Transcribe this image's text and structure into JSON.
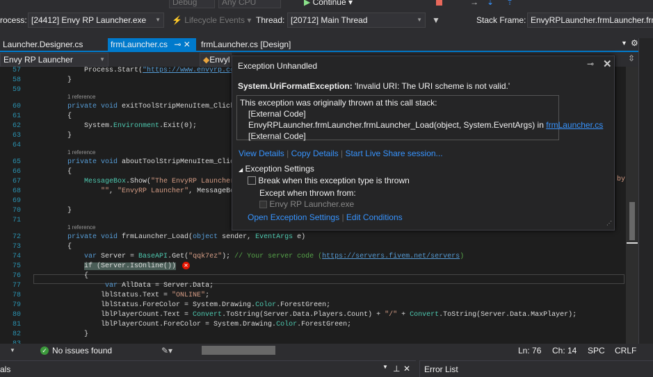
{
  "toolbar": {
    "config": "Debug",
    "platform": "Any CPU",
    "continue_label": "Continue"
  },
  "debug_bar": {
    "process_label": "rocess:",
    "process_value": "[24412] Envy RP Launcher.exe",
    "lifecycle_label": "Lifecycle Events",
    "thread_label": "Thread:",
    "thread_value": "[20712] Main Thread",
    "stack_frame_label": "Stack Frame:",
    "stack_frame_value": "EnvyRPLauncher.frmLauncher.frmL"
  },
  "tabs": [
    {
      "label": "Launcher.Designer.cs"
    },
    {
      "label": "frmLauncher.cs"
    },
    {
      "label": "frmLauncher.cs [Design]"
    }
  ],
  "navbar": {
    "project": "Envy RP Launcher",
    "class": "Envyl"
  },
  "code_lines": [
    {
      "n": "57",
      "tokens": [
        [
          "            Process.Start(",
          ""
        ],
        [
          "\"https://www.envyrp.co",
          "lk"
        ]
      ]
    },
    {
      "n": "58",
      "tokens": [
        [
          "        }",
          ""
        ]
      ]
    },
    {
      "n": "59",
      "tokens": []
    },
    {
      "ref": "1 reference"
    },
    {
      "n": "60",
      "tokens": [
        [
          "        ",
          ""
        ],
        [
          "private void ",
          "kw"
        ],
        [
          "exitToolStripMenuItem_Click",
          ""
        ]
      ]
    },
    {
      "n": "61",
      "tokens": [
        [
          "        {",
          ""
        ]
      ]
    },
    {
      "n": "62",
      "tokens": [
        [
          "            System.",
          ""
        ],
        [
          "Environment",
          "ty"
        ],
        [
          ".Exit(0);",
          ""
        ]
      ]
    },
    {
      "n": "63",
      "tokens": [
        [
          "        }",
          ""
        ]
      ]
    },
    {
      "n": "64",
      "tokens": []
    },
    {
      "ref": "1 reference"
    },
    {
      "n": "65",
      "tokens": [
        [
          "        ",
          ""
        ],
        [
          "private void ",
          "kw"
        ],
        [
          "aboutToolStripMenuItem_Clic",
          ""
        ]
      ]
    },
    {
      "n": "66",
      "tokens": [
        [
          "        {",
          ""
        ]
      ]
    },
    {
      "n": "67",
      "tokens": [
        [
          "            ",
          ""
        ],
        [
          "MessageBox",
          "ty"
        ],
        [
          ".Show(",
          ""
        ],
        [
          "\"The EnvyRP Launcher",
          "st"
        ]
      ]
    },
    {
      "n": "68",
      "tokens": [
        [
          "                ",
          ""
        ],
        [
          "\"\"",
          "st"
        ],
        [
          ", ",
          ""
        ],
        [
          "\"EnvyRP Launcher\"",
          "st"
        ],
        [
          ", MessageBo",
          ""
        ]
      ]
    },
    {
      "n": "69",
      "tokens": []
    },
    {
      "n": "70",
      "tokens": [
        [
          "        }",
          ""
        ]
      ]
    },
    {
      "n": "71",
      "tokens": []
    },
    {
      "ref": "1 reference"
    },
    {
      "n": "72",
      "tokens": [
        [
          "        ",
          ""
        ],
        [
          "private void ",
          "kw"
        ],
        [
          "frmLauncher_Load(",
          ""
        ],
        [
          "object ",
          "kw"
        ],
        [
          "sender, ",
          ""
        ],
        [
          "EventArgs",
          "ty"
        ],
        [
          " e)",
          ""
        ]
      ]
    },
    {
      "n": "73",
      "tokens": [
        [
          "        {",
          ""
        ]
      ]
    },
    {
      "n": "74",
      "tokens": [
        [
          "            ",
          ""
        ],
        [
          "var ",
          "kw"
        ],
        [
          "Server = ",
          ""
        ],
        [
          "BaseAPI",
          "ty"
        ],
        [
          ".Get(",
          ""
        ],
        [
          "\"qqk7ez\"",
          "st"
        ],
        [
          "); ",
          ""
        ],
        [
          "// Your server code (",
          "cm"
        ],
        [
          "https://servers.fivem.net/servers",
          "lk"
        ],
        [
          ")",
          "cm"
        ]
      ]
    },
    {
      "n": "75",
      "tokens": [
        [
          "            ",
          ""
        ],
        [
          "if (Server.IsOnline())",
          "hl"
        ]
      ]
    },
    {
      "n": "76",
      "tokens": [
        [
          "            {",
          ""
        ]
      ]
    },
    {
      "n": "77",
      "tokens": [
        [
          "                 ",
          ""
        ],
        [
          "var ",
          "kw"
        ],
        [
          "AllData = Server.Data;",
          ""
        ]
      ]
    },
    {
      "n": "78",
      "tokens": [
        [
          "                lblStatus.Text = ",
          ""
        ],
        [
          "\"ONLINE\"",
          "st"
        ],
        [
          ";",
          ""
        ]
      ]
    },
    {
      "n": "79",
      "tokens": [
        [
          "                lblStatus.ForeColor = System.Drawing.",
          ""
        ],
        [
          "Color",
          "ty"
        ],
        [
          ".ForestGreen;",
          ""
        ]
      ]
    },
    {
      "n": "80",
      "tokens": [
        [
          "                lblPlayerCount.Text = ",
          ""
        ],
        [
          "Convert",
          "ty"
        ],
        [
          ".ToString(Server.Data.Players.Count) + ",
          ""
        ],
        [
          "\"/\"",
          "st"
        ],
        [
          " + ",
          ""
        ],
        [
          "Convert",
          "ty"
        ],
        [
          ".ToString(Server.Data.MaxPlayer);",
          ""
        ]
      ]
    },
    {
      "n": "81",
      "tokens": [
        [
          "                lblPlayerCount.ForeColor = System.Drawing.",
          ""
        ],
        [
          "Color",
          "ty"
        ],
        [
          ".ForestGreen;",
          ""
        ]
      ]
    },
    {
      "n": "82",
      "tokens": [
        [
          "            }",
          ""
        ]
      ]
    },
    {
      "n": "83",
      "tokens": []
    }
  ],
  "code_overflow": "by",
  "exception": {
    "title": "Exception Unhandled",
    "type": "System.UriFormatException:",
    "message": "'Invalid URI: The URI scheme is not valid.'",
    "stack_header": "This exception was originally thrown at this call stack:",
    "stack": [
      "[External Code]",
      "EnvyRPLauncher.frmLauncher.frmLauncher_Load(object, System.EventArgs) in ",
      "[External Code]"
    ],
    "stack_link": "frmLauncher.cs",
    "view_details": "View Details",
    "copy_details": "Copy Details",
    "live_share": "Start Live Share session...",
    "settings_header": "Exception Settings",
    "break_label": "Break when this exception type is thrown",
    "except_label": "Except when thrown from:",
    "module_label": "Envy RP Launcher.exe",
    "open_settings": "Open Exception Settings",
    "edit_conditions": "Edit Conditions"
  },
  "status": {
    "issues": "No issues found",
    "line": "Ln: 76",
    "col": "Ch: 14",
    "spc": "SPC",
    "crlf": "CRLF"
  },
  "bottom": {
    "left_pane": "als",
    "right_pane": "Error List"
  }
}
